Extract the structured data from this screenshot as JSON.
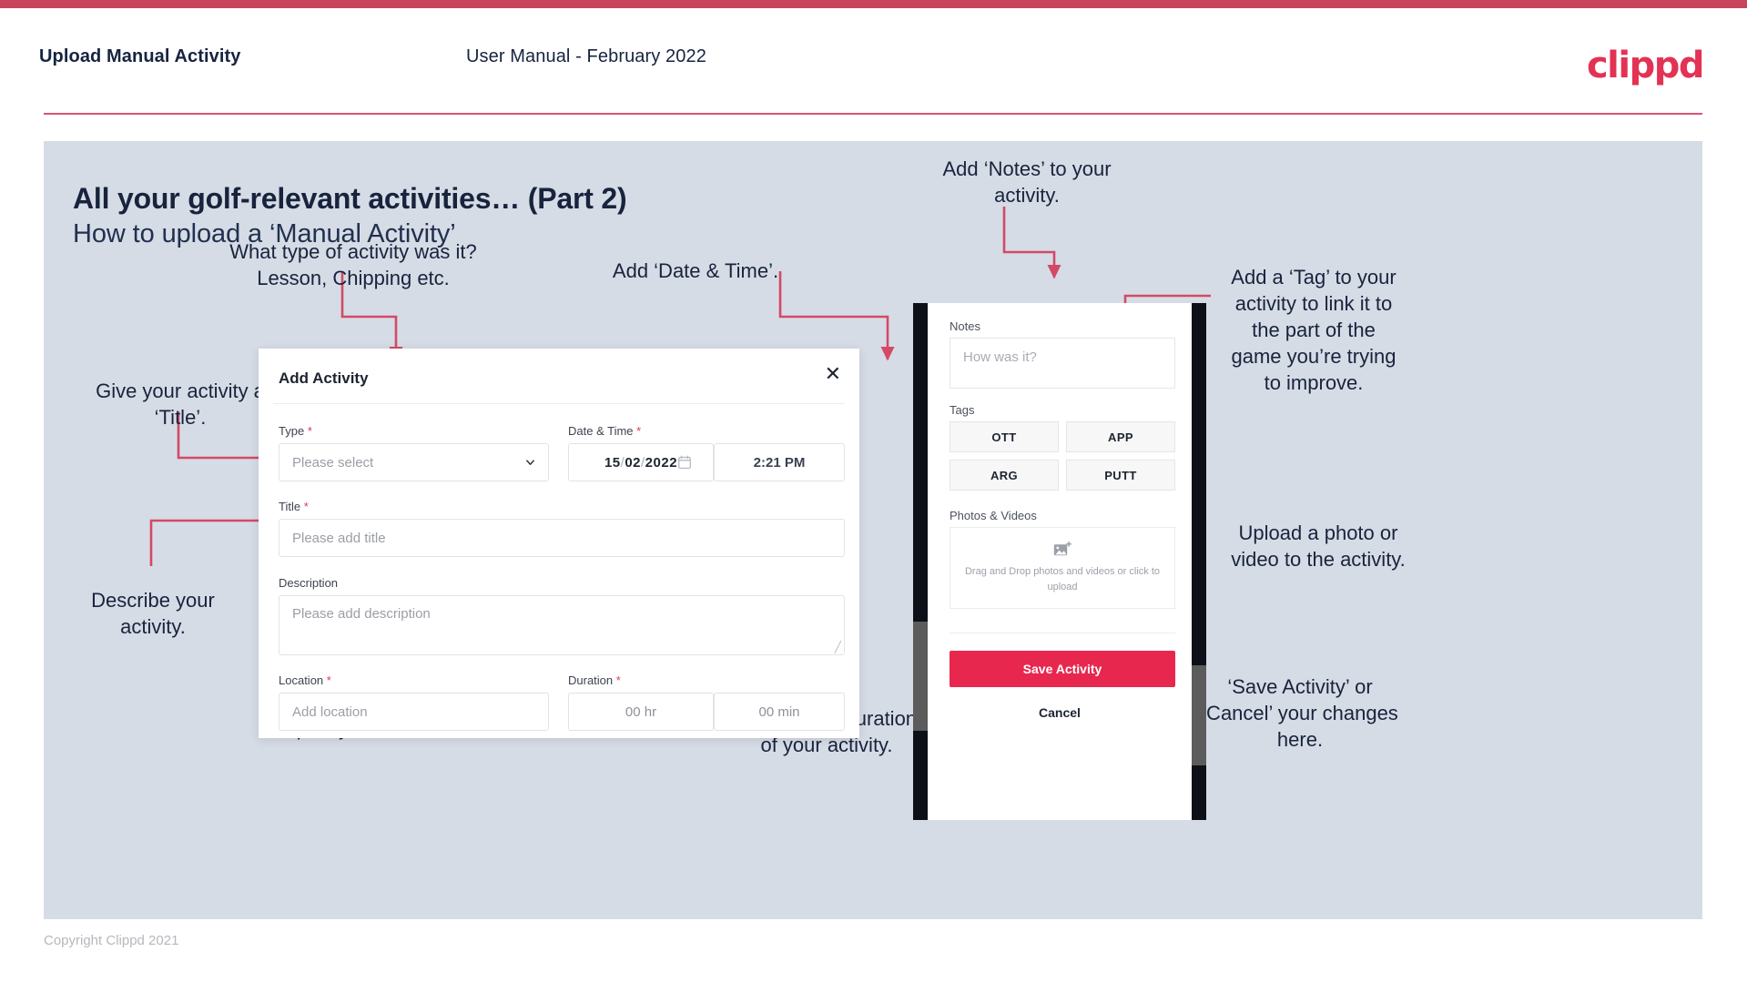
{
  "header": {
    "left_title": "Upload Manual Activity",
    "center_title": "User Manual - February 2022",
    "logo": "clippd"
  },
  "slide": {
    "title": "All your golf-relevant activities… (Part 2)",
    "subtitle": "How to upload a ‘Manual Activity’"
  },
  "annotations": {
    "type": "What type of activity was it?\nLesson, Chipping etc.",
    "datetime": "Add ‘Date & Time’.",
    "title": "Give your activity a\n‘Title’.",
    "description": "Describe your\nactivity.",
    "location": "Specify the ‘Location’.",
    "duration": "Specify the ‘Duration’\nof your activity.",
    "notes": "Add ‘Notes’ to your\nactivity.",
    "tags": "Add a ‘Tag’ to your\nactivity to link it to\nthe part of the\ngame you’re trying\nto improve.",
    "photos": "Upload a photo or\nvideo to the activity.",
    "save": "‘Save Activity’ or\n‘Cancel’ your changes\nhere."
  },
  "dialog": {
    "title": "Add Activity",
    "close_icon": "close-icon",
    "fields": {
      "type": {
        "label": "Type",
        "required": "*",
        "placeholder": "Please select",
        "icon": "chevron-down-icon"
      },
      "datetime": {
        "label": "Date & Time",
        "required": "*",
        "day": "15",
        "sep1": "/",
        "month": "02",
        "sep2": "/",
        "year": "2022",
        "icon": "calendar-icon",
        "time": "2:21 PM"
      },
      "title": {
        "label": "Title",
        "required": "*",
        "placeholder": "Please add title"
      },
      "description": {
        "label": "Description",
        "required": "",
        "placeholder": "Please add description"
      },
      "location": {
        "label": "Location",
        "required": "*",
        "placeholder": "Add location"
      },
      "duration": {
        "label": "Duration",
        "required": "*",
        "hours": "00 hr",
        "minutes": "00 min"
      }
    }
  },
  "phone": {
    "notes_label": "Notes",
    "notes_placeholder": "How was it?",
    "tags_label": "Tags",
    "tags": [
      "OTT",
      "APP",
      "ARG",
      "PUTT"
    ],
    "photos_label": "Photos & Videos",
    "drop_icon": "add-image-icon",
    "drop_text": "Drag and Drop photos and videos or\nclick to upload",
    "save_label": "Save Activity",
    "cancel_label": "Cancel"
  },
  "footer": {
    "copyright": "Copyright Clippd 2021"
  },
  "colors": {
    "brand": "#e33254",
    "accent_rule": "#c8445e",
    "slide_bg": "#d6dce5",
    "text_dark": "#18233d",
    "save_button": "#e8274f",
    "arrow": "#d24a66"
  }
}
